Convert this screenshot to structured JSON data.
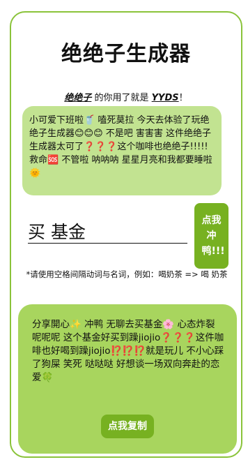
{
  "app": {
    "title": "绝绝子生成器",
    "subtitle_emphasis_1": "绝绝子",
    "subtitle_mid": " 的你用了就是 ",
    "subtitle_emphasis_2": "YYDS",
    "subtitle_end": "！"
  },
  "intro_text": "小可爱下班啦🥤 嗑死莫拉 今天去体验了玩绝绝子生成器😊😊😊 不是吧 害害害 这件绝绝子生成器太可了❓❓❓这个咖啡也绝绝子!!!!!救命🆘 不管啦 呐呐呐 星星月亮和我都要睡啦🌞",
  "input": {
    "value": "买 基金",
    "placeholder": ""
  },
  "go_button_label": "点我冲鸭!!!",
  "hint": "*请使用空格间隔动词与名词，例如：喝奶茶 => 喝 奶茶",
  "result_text": "分享開心✨ 冲鸭 无聊去买基金🌸 心态炸裂 呢呢呢 这个基金好买到躁jiojio❓❓❓这件咖啡也好喝到躁jiojio⁉️⁉️⁉️就是玩儿 不小心踩了狗屎 笑死 哒哒哒 好想谈一场双向奔赴的恋爱🍀",
  "copy_button_label": "点我复制",
  "colors": {
    "accent": "#77b121",
    "border": "#8ac33a",
    "bubble_light": "#c2e391",
    "bubble_dark": "#a8d55e"
  }
}
